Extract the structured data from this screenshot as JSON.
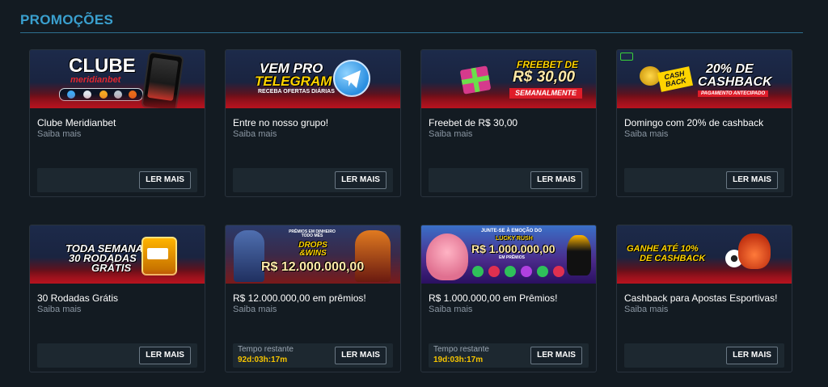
{
  "section": {
    "title": "PROMOÇÕES"
  },
  "cards": [
    {
      "banner": {
        "line1": "CLUBE",
        "line2": "meridianbet"
      },
      "title": "Clube Meridianbet",
      "subtitle": "Saiba mais",
      "button": "LER MAIS"
    },
    {
      "banner": {
        "line1": "VEM PRO",
        "line2": "TELEGRAM",
        "line3": "RECEBA OFERTAS DIÁRIAS"
      },
      "title": "Entre no nosso grupo!",
      "subtitle": "Saiba mais",
      "button": "LER MAIS"
    },
    {
      "banner": {
        "line1": "FREEBET DE",
        "line2": "R$ 30,00",
        "line3": "SEMANALMENTE"
      },
      "title": "Freebet de R$ 30,00",
      "subtitle": "Saiba mais",
      "button": "LER MAIS"
    },
    {
      "banner": {
        "line1": "20% DE",
        "line2": "CASHBACK",
        "line3": "PAGAMENTO ANTECIPADO",
        "badge": "CASH BACK"
      },
      "title": "Domingo com 20% de cashback",
      "subtitle": "Saiba mais",
      "button": "LER MAIS"
    },
    {
      "banner": {
        "line1": "TODA SEMANA",
        "line2": "30 RODADAS",
        "line3": "GRÁTIS"
      },
      "title": "30 Rodadas Grátis",
      "subtitle": "Saiba mais",
      "button": "LER MAIS"
    },
    {
      "banner": {
        "line1": "PRÊMIOS EM DINHEIRO TODO MÊS",
        "line2": "DROPS &WINS",
        "line3": "R$ 12.000.000,00"
      },
      "title": "R$ 12.000.000,00 em prêmios!",
      "subtitle": "Saiba mais",
      "timer_label": "Tempo restante",
      "timer_value": "92d:03h:17m",
      "button": "LER MAIS"
    },
    {
      "banner": {
        "line1": "JUNTE-SE À EMOÇÃO DO",
        "line2": "LUCKY RUSH",
        "line3": "R$ 1.000.000,00",
        "line4": "EM PRÊMIOS"
      },
      "title": "R$ 1.000.000,00 em Prêmios!",
      "subtitle": "Saiba mais",
      "timer_label": "Tempo restante",
      "timer_value": "19d:03h:17m",
      "button": "LER MAIS"
    },
    {
      "banner": {
        "line1": "GANHE ATÉ 10%",
        "line2": "DE CASHBACK"
      },
      "title": "Cashback para Apostas Esportivas!",
      "subtitle": "Saiba mais",
      "button": "LER MAIS"
    }
  ]
}
